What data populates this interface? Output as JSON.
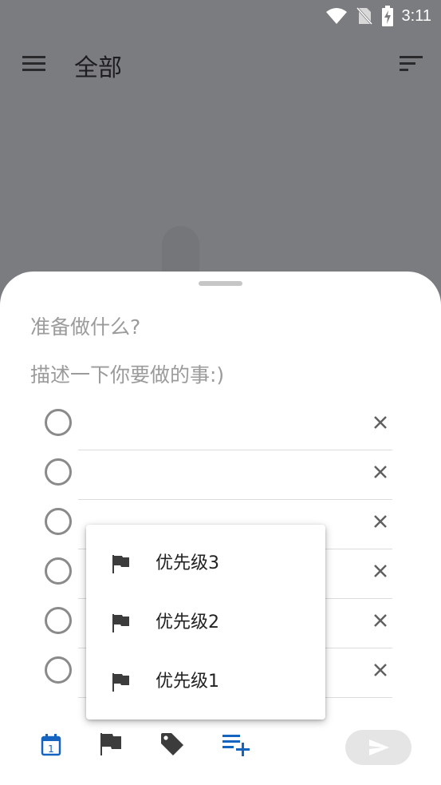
{
  "status_bar": {
    "time": "3:11"
  },
  "app_bar": {
    "title": "全部"
  },
  "task": {
    "title_placeholder": "准备做什么?",
    "desc_placeholder": "描述一下你要做的事:)"
  },
  "priority_menu": {
    "items": [
      {
        "label": "优先级3"
      },
      {
        "label": "优先级2"
      },
      {
        "label": "优先级1"
      }
    ]
  },
  "icons": {
    "menu": "menu-icon",
    "sort": "sort-icon",
    "calendar": "calendar-icon",
    "calendar_day": "1",
    "flag": "flag-icon",
    "tag": "tag-icon",
    "add_subtask": "playlist-add-icon",
    "send": "send-icon"
  },
  "colors": {
    "accent": "#1565c0",
    "icon_dark": "#3c3c3c",
    "placeholder": "#9b9b9b"
  }
}
